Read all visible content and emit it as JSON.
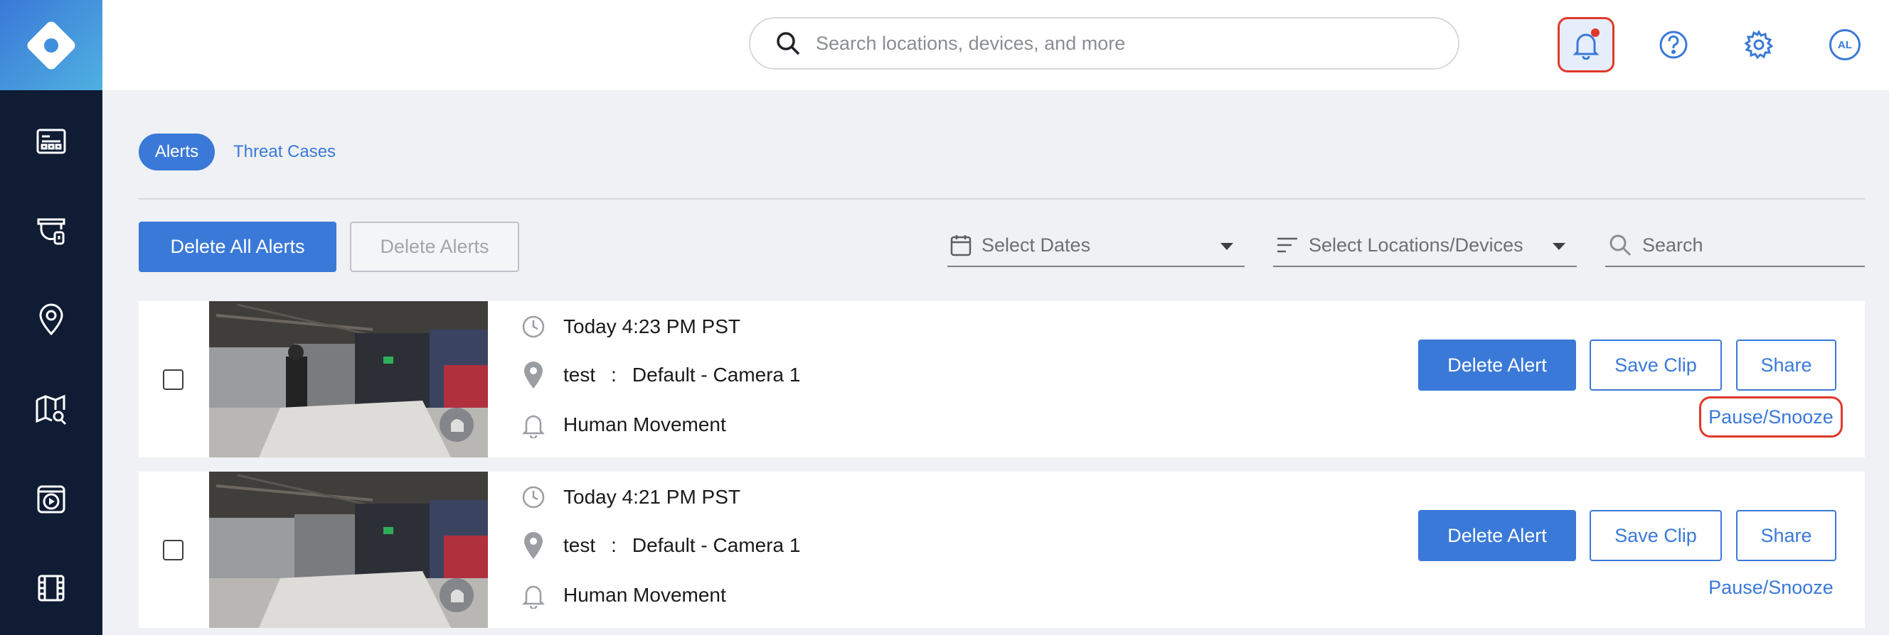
{
  "header": {
    "search_placeholder": "Search locations, devices, and more",
    "avatar_initials": "AL"
  },
  "sidebar": {
    "items": [
      "dashboard-icon",
      "security-camera-icon",
      "location-pin-icon",
      "map-search-icon",
      "video-player-icon",
      "film-icon"
    ]
  },
  "tabs": [
    {
      "label": "Alerts",
      "active": true
    },
    {
      "label": "Threat Cases",
      "active": false
    }
  ],
  "toolbar": {
    "delete_all_label": "Delete All Alerts",
    "delete_selected_label": "Delete Alerts",
    "dates_label": "Select Dates",
    "locations_label": "Select Locations/Devices",
    "search_label": "Search"
  },
  "alerts": [
    {
      "time": "Today 4:23 PM PST",
      "location": "test",
      "separator": ":",
      "device": "Default - Camera 1",
      "type": "Human Movement",
      "delete_label": "Delete Alert",
      "save_label": "Save Clip",
      "share_label": "Share",
      "pause_label": "Pause/Snooze"
    },
    {
      "time": "Today 4:21 PM PST",
      "location": "test",
      "separator": ":",
      "device": "Default - Camera 1",
      "type": "Human Movement",
      "delete_label": "Delete Alert",
      "save_label": "Save Clip",
      "share_label": "Share",
      "pause_label": "Pause/Snooze"
    }
  ],
  "colors": {
    "accent": "#3a79d8",
    "sidebar": "#0f1c33",
    "highlight": "#e0382b"
  }
}
